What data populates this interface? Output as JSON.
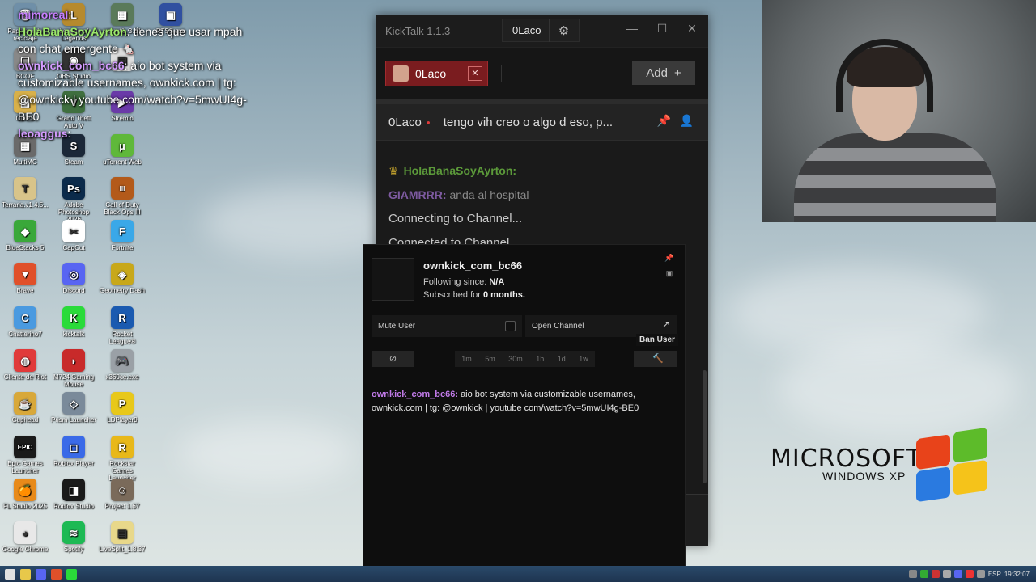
{
  "overlay_chat": {
    "line1_user": "mimoreal",
    "line1_text": ":",
    "line2_user": "HolaBanaSoyAyrton",
    "line2_text": ": tienes que usar mpah con chat emergente 🐁",
    "line3_user": "ownkick_com_bc66",
    "line3_text": ": aio bot system via customizable usernames, ownkick.com | tg: @ownkick | youtube com/watch?v=5mwUI4g-BE0",
    "line4_user": "leoaggus",
    "line4_text": ":"
  },
  "desktop_icons": [
    {
      "label": "Papelera de reciclaje",
      "color": "#6f8fa8",
      "glyph": "🗑"
    },
    {
      "label": "League of Legends",
      "color": "#b68a2e",
      "glyph": "L"
    },
    {
      "label": "xinput1_3.dll",
      "color": "#5a7a5a",
      "glyph": "▦"
    },
    {
      "label": "RTSS.exe",
      "color": "#3050a0",
      "glyph": "▣"
    },
    {
      "label": "BCQF",
      "color": "#888888",
      "glyph": "▢"
    },
    {
      "label": "OBS Studio",
      "color": "#333333",
      "glyph": "◉"
    },
    {
      "label": "",
      "color": "#dddddd",
      "glyph": "▤"
    },
    {
      "label": "CLIPS",
      "color": "#d8b04a",
      "glyph": "▥"
    },
    {
      "label": "Grand Theft Auto V",
      "color": "#3f6f3f",
      "glyph": "V"
    },
    {
      "label": "Stremio",
      "color": "#6a3aa8",
      "glyph": "▶"
    },
    {
      "label": "MultiMC",
      "color": "#6a6a6a",
      "glyph": "▦"
    },
    {
      "label": "Steam",
      "color": "#1b2838",
      "glyph": "S"
    },
    {
      "label": "uTorrent Web",
      "color": "#5fb83a",
      "glyph": "µ"
    },
    {
      "label": "Terraria.v1.4.5...",
      "color": "#d8c48a",
      "glyph": "T"
    },
    {
      "label": "Adobe Photoshop 2026",
      "color": "#0b2a4a",
      "glyph": "Ps"
    },
    {
      "label": "Call of Duty Black Ops III",
      "color": "#b35a1a",
      "glyph": "III"
    },
    {
      "label": "BlueStacks 5",
      "color": "#3aa83a",
      "glyph": "◆"
    },
    {
      "label": "CapCut",
      "color": "#ffffff",
      "glyph": "✂"
    },
    {
      "label": "Fortnite",
      "color": "#3aa8e8",
      "glyph": "F"
    },
    {
      "label": "Brave",
      "color": "#e0502a",
      "glyph": "▼"
    },
    {
      "label": "Discord",
      "color": "#5865f2",
      "glyph": "◎"
    },
    {
      "label": "Geometry Dash",
      "color": "#c8a81a",
      "glyph": "◈"
    },
    {
      "label": "Chatterino7",
      "color": "#4a9ae0",
      "glyph": "C"
    },
    {
      "label": "kicktalk",
      "color": "#2adb3a",
      "glyph": "K"
    },
    {
      "label": "Rocket League®",
      "color": "#1a5ab0",
      "glyph": "R"
    },
    {
      "label": "Cliente de Riot",
      "color": "#e03a3a",
      "glyph": "◍"
    },
    {
      "label": "M724 Gaming Mouse",
      "color": "#c82a2a",
      "glyph": "◗"
    },
    {
      "label": "x360ce.exe",
      "color": "#9aa0a6",
      "glyph": "🎮"
    },
    {
      "label": "Cuphead",
      "color": "#d8a83a",
      "glyph": "☕"
    },
    {
      "label": "Prism Launcher",
      "color": "#7a8a9a",
      "glyph": "◇"
    },
    {
      "label": "LDPlayer9",
      "color": "#e8c81a",
      "glyph": "P"
    },
    {
      "label": "Epic Games Launcher",
      "color": "#1a1a1a",
      "glyph": "EPIC"
    },
    {
      "label": "Roblox Player",
      "color": "#3a6ae8",
      "glyph": "◻"
    },
    {
      "label": "Rockstar Games Launcher",
      "color": "#e8b81a",
      "glyph": "R"
    },
    {
      "label": "FL Studio 2025",
      "color": "#e88a1a",
      "glyph": "🍊"
    },
    {
      "label": "Roblox Studio",
      "color": "#1a1a1a",
      "glyph": "◨"
    },
    {
      "label": "Project 1.67",
      "color": "#7a6a5a",
      "glyph": "☺"
    },
    {
      "label": "Google Chrome",
      "color": "#e8e8e8",
      "glyph": "◕"
    },
    {
      "label": "Spotify",
      "color": "#1db954",
      "glyph": "≋"
    },
    {
      "label": "LiveSplit_1.8.37",
      "color": "#e8d88a",
      "glyph": "▤"
    }
  ],
  "xp_logo": {
    "microsoft": "MICROSOFT",
    "windows": "WINDOWS XP"
  },
  "app": {
    "title": "KickTalk 1.1.3",
    "user_tab": "0Laco",
    "gear_icon": "⚙",
    "minimize": "—",
    "maximize": "☐",
    "close": "✕"
  },
  "tabs": {
    "channel": "0Laco",
    "close": "✕",
    "add_label": "Add",
    "add_icon": "+"
  },
  "pinned": {
    "user": "0Laco",
    "live_dot": "●",
    "message": "tengo vih creo o algo d eso, p...",
    "pin_icon": "📌",
    "user_icon": "👤"
  },
  "messages": {
    "m1_user": "HolaBanaSoyAyrton:",
    "m2_user": "GIAMRRR:",
    "m2_text": "anda al hospital",
    "sys1": "Connecting to Channel...",
    "sys2": "Connected to Channel"
  },
  "popup": {
    "username": "ownkick_com_bc66",
    "following_label": "Following since:",
    "following_value": "N/A",
    "subscribed_prefix": "Subscribed for",
    "subscribed_value": "0 months.",
    "mute_label": "Mute User",
    "open_channel_label": "Open Channel",
    "open_icon": "↗",
    "pin_icon": "📌",
    "copy_icon": "▣",
    "ban_circle_icon": "⊘",
    "timeouts": [
      "1m",
      "5m",
      "30m",
      "1h",
      "1d",
      "1w"
    ],
    "ban_icon": "🔨",
    "ban_tooltip": "Ban User",
    "msg_user": "ownkick_com_bc66:",
    "msg_text": "aio bot system via customizable usernames, ownkick.com | tg: @ownkick | youtube com/watch?v=5mwUI4g-BE0"
  },
  "taskbar": {
    "lang": "ESP",
    "time": "19:32:07"
  }
}
